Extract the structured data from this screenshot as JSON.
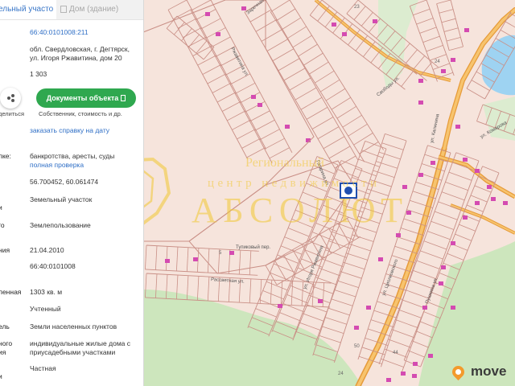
{
  "panel": {
    "tabs": [
      {
        "label": "ельный участок"
      },
      {
        "label": "Дом (здание)"
      }
    ],
    "cadastral_number": "66:40:0101008:211",
    "address_line1": "обл. Свердловская, г. Дегтярск,",
    "address_line2": "ул. Игоря Ржавитина, дом 20",
    "area_short": "1 303",
    "share_label": "делиться",
    "docs_button": "Документы объекта",
    "docs_sub": "Собственник, стоимость и др.",
    "order_link": "заказать справку на дату",
    "checks_label": "лке:",
    "checks_value": "банкротства, аресты, суды",
    "full_check_link": "полная проверка",
    "coords": "56.700452, 60.061474",
    "rows": [
      {
        "label": "и",
        "value": "Земельный участок"
      },
      {
        "label": "го",
        "value": "Землепользование"
      },
      {
        "label": "ния",
        "value": "21.04.2010"
      },
      {
        "label": "",
        "value": "66:40:0101008"
      },
      {
        "label": "ленная",
        "value": "1303 кв. м"
      },
      {
        "label": "",
        "value": "Учтенный"
      },
      {
        "label": "ель",
        "value": "Земли населенных пунктов"
      },
      {
        "label": "ного",
        "value": "индивидуальные жилые дома с"
      },
      {
        "label": "ия",
        "value": "приусадебными участками"
      },
      {
        "label": "и",
        "value": "Частная"
      }
    ]
  },
  "map": {
    "streets": [
      {
        "name": "Ржавитина ул."
      },
      {
        "name": "Гагарина ул."
      },
      {
        "name": "Тупиковый пер."
      },
      {
        "name": "Рассветная ул."
      },
      {
        "name": "ул. Игоря Ржавитина"
      },
      {
        "name": "ул. Циолковского"
      },
      {
        "name": "ул. Калинина"
      },
      {
        "name": "ул. Комарова"
      },
      {
        "name": "Пушкина ул."
      },
      {
        "name": "Свободы ул."
      },
      {
        "name": "Заречная ул."
      }
    ],
    "parcel_numbers": [
      "23",
      "24",
      "5",
      "24",
      "44",
      "50"
    ],
    "colors": {
      "background": "#f6e4dc",
      "parcel_line": "#c98f86",
      "road": "#f5b45a",
      "road_edge": "#e69b3a",
      "water": "#9ed3f2",
      "green": "#cde6bd",
      "building": "#d44bb1",
      "marker": "#1f4fb0"
    }
  },
  "watermark": {
    "line1": "Региональный",
    "line2": "центр недвижимости",
    "brand": "АБСОЛЮТ",
    "color": "#f1c832"
  },
  "logo": {
    "text": "move"
  }
}
